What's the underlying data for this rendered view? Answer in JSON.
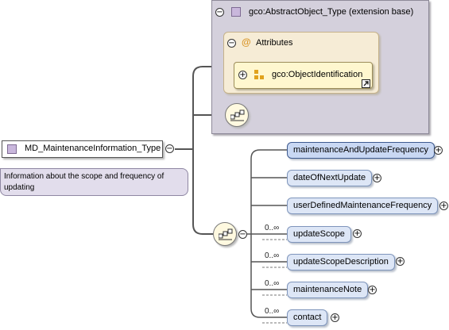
{
  "root": {
    "name": "MD_MaintenanceInformation_Type",
    "documentation": "Information about the scope and frequency of updating"
  },
  "extension": {
    "label": "gco:AbstractObject_Type (extension base)",
    "attributes_label": "Attributes",
    "attribute_ref": "gco:ObjectIdentification"
  },
  "elements": [
    {
      "name": "maintenanceAndUpdateFrequency",
      "occurrence": "",
      "selected": true
    },
    {
      "name": "dateOfNextUpdate",
      "occurrence": ""
    },
    {
      "name": "userDefinedMaintenanceFrequency",
      "occurrence": ""
    },
    {
      "name": "updateScope",
      "occurrence": "0..∞"
    },
    {
      "name": "updateScopeDescription",
      "occurrence": "0..∞"
    },
    {
      "name": "maintenanceNote",
      "occurrence": "0..∞"
    },
    {
      "name": "contact",
      "occurrence": "0..∞"
    }
  ],
  "colors": {
    "extension_bg": "#d4d0dc",
    "attributes_bg": "#f6ecd6",
    "element_bg": "#dde6f6",
    "connector": "#555555"
  }
}
